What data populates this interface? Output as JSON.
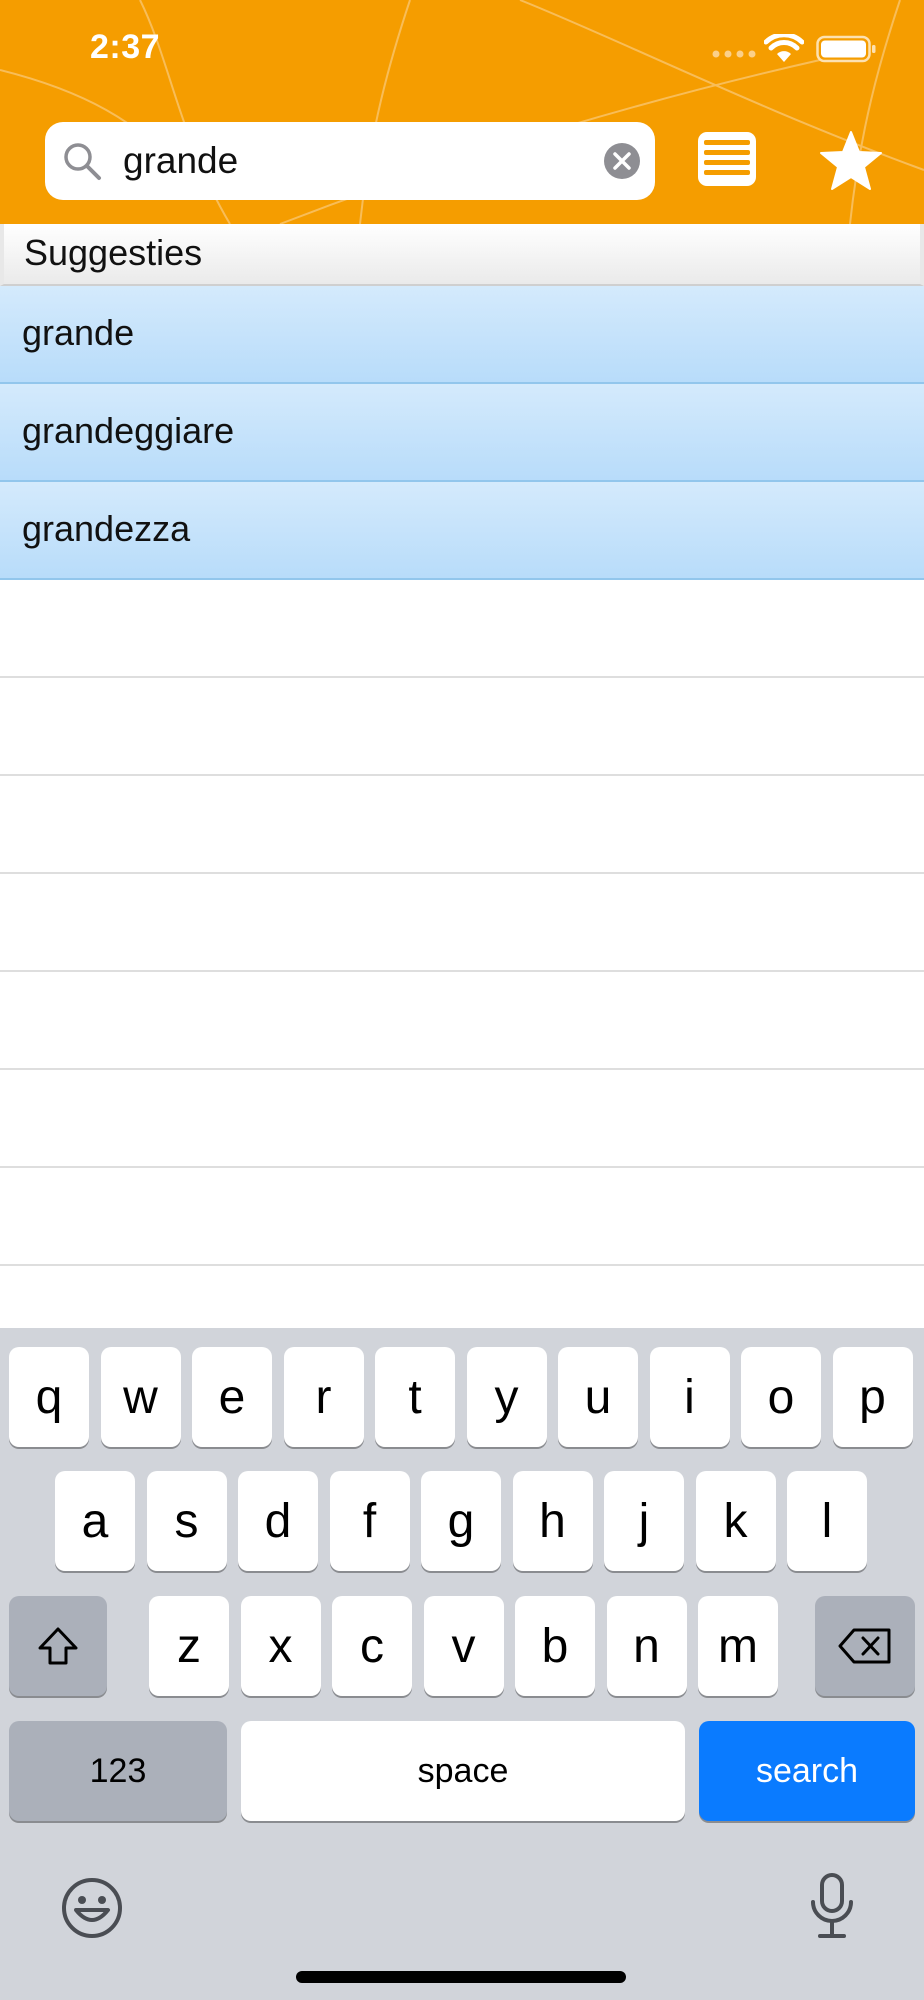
{
  "colors": {
    "header_orange": "#f59d00",
    "suggestion_blue": "#c5e3fb",
    "search_key_blue": "#0a7bff",
    "keyboard_bg": "#d1d4da"
  },
  "status_bar": {
    "time": "2:37",
    "icons": [
      "cellular-signal-icon",
      "wifi-icon",
      "battery-icon"
    ]
  },
  "search": {
    "value": "grande",
    "clear_icon": "clear-icon",
    "search_icon": "magnifier-icon"
  },
  "toolbar": {
    "list_icon": "list-icon",
    "favorites_icon": "star-icon"
  },
  "suggestions": {
    "title": "Suggesties",
    "items": [
      {
        "label": "grande"
      },
      {
        "label": "grandeggiare"
      },
      {
        "label": "grandezza"
      }
    ]
  },
  "keyboard": {
    "row1": [
      "q",
      "w",
      "e",
      "r",
      "t",
      "y",
      "u",
      "i",
      "o",
      "p"
    ],
    "row2": [
      "a",
      "s",
      "d",
      "f",
      "g",
      "h",
      "j",
      "k",
      "l"
    ],
    "row3": [
      "z",
      "x",
      "c",
      "v",
      "b",
      "n",
      "m"
    ],
    "numbers_label": "123",
    "space_label": "space",
    "search_label": "search",
    "shift_icon": "shift-icon",
    "backspace_icon": "backspace-icon",
    "emoji_icon": "emoji-icon",
    "mic_icon": "microphone-icon"
  }
}
